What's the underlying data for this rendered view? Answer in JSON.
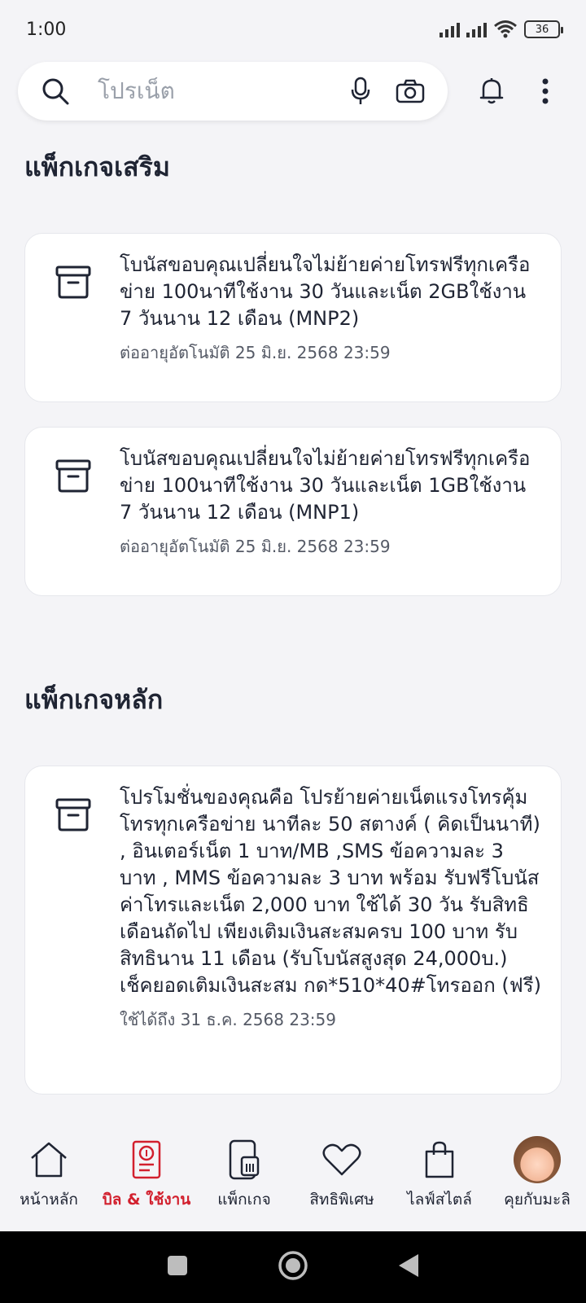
{
  "status_bar": {
    "time": "1:00",
    "battery": "36"
  },
  "search": {
    "placeholder": "โปรเน็ต"
  },
  "sections": {
    "addon_title": "แพ็กเกจเสริม",
    "main_title": "แพ็กเกจหลัก"
  },
  "addon_cards": [
    {
      "title": "โบนัสขอบคุณเปลี่ยนใจไม่ย้ายค่ายโทรฟรีทุกเครือข่าย 100นาทีใช้งาน 30 วันและเน็ต 2GBใช้งาน 7 วันนาน 12 เดือน (MNP2)",
      "subtitle": "ต่ออายุอัตโนมัติ 25 มิ.ย. 2568 23:59"
    },
    {
      "title": "โบนัสขอบคุณเปลี่ยนใจไม่ย้ายค่ายโทรฟรีทุกเครือข่าย 100นาทีใช้งาน 30 วันและเน็ต 1GBใช้งาน 7 วันนาน 12 เดือน (MNP1)",
      "subtitle": "ต่ออายุอัตโนมัติ 25 มิ.ย. 2568 23:59"
    }
  ],
  "main_card": {
    "title": "โปรโมชั่นของคุณคือ โปรย้ายค่ายเน็ตแรงโทรคุ้ม โทรทุกเครือข่าย นาทีละ 50 สตางค์ ( คิดเป็นนาที) , อินเตอร์เน็ต 1 บาท/MB ,SMS ข้อความละ 3 บาท , MMS ข้อความละ 3 บาท พร้อม รับฟรีโบนัสค่าโทรและเน็ต 2,000 บาท ใช้ได้ 30 วัน รับสิทธิเดือนถัดไป เพียงเติมเงินสะสมครบ 100 บาท รับสิทธินาน 11 เดือน (รับโบนัสสูงสุด 24,000บ.) เช็คยอดเติมเงินสะสม กด*510*40#โทรออก (ฟรี)",
    "subtitle": "ใช้ได้ถึง 31 ธ.ค. 2568 23:59"
  },
  "bottom_nav": [
    {
      "label": "หน้าหลัก",
      "icon": "home-icon"
    },
    {
      "label": "บิล & ใช้งาน",
      "icon": "bill-icon",
      "active": true
    },
    {
      "label": "แพ็กเกจ",
      "icon": "sim-package-icon"
    },
    {
      "label": "สิทธิพิเศษ",
      "icon": "heart-icon"
    },
    {
      "label": "ไลฟ์สไตล์",
      "icon": "shopping-bag-icon"
    },
    {
      "label": "คุยกับมะลิ",
      "icon": "avatar-icon"
    }
  ],
  "colors": {
    "accent": "#d2202e",
    "background": "#f4f4f7",
    "text": "#1f2433"
  }
}
